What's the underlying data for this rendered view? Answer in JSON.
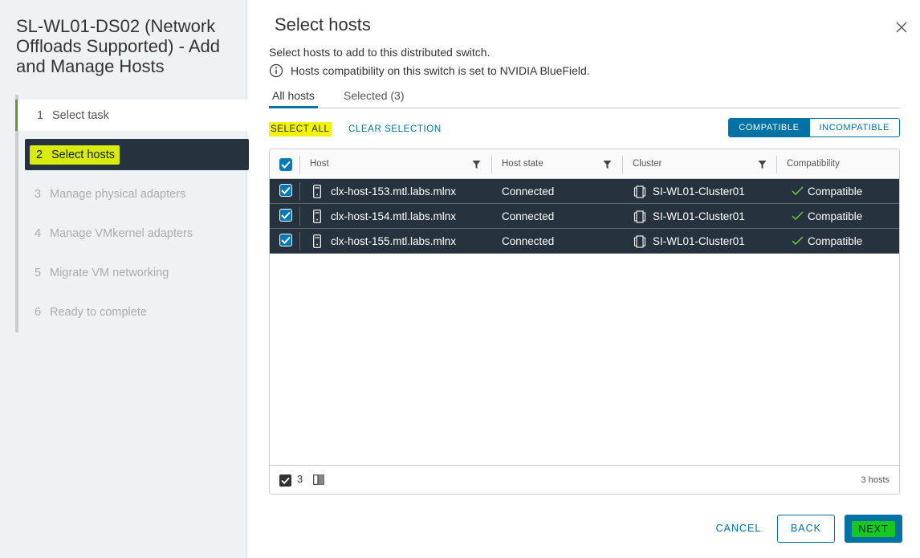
{
  "wizard": {
    "title": "SL-WL01-DS02 (Network Offloads Supported) - Add and Manage Hosts",
    "steps": [
      {
        "num": "1",
        "label": "Select task"
      },
      {
        "num": "2",
        "label": "Select hosts"
      },
      {
        "num": "3",
        "label": "Manage physical adapters"
      },
      {
        "num": "4",
        "label": "Manage VMkernel adapters"
      },
      {
        "num": "5",
        "label": "Migrate VM networking"
      },
      {
        "num": "6",
        "label": "Ready to complete"
      }
    ]
  },
  "page": {
    "title": "Select hosts",
    "subtitle": "Select hosts to add to this distributed switch.",
    "compat_note": "Hosts compatibility on this switch is set to NVIDIA BlueField."
  },
  "tabs": {
    "all": "All hosts",
    "selected": "Selected (3)"
  },
  "actions": {
    "select_all": "SELECT ALL",
    "clear_selection": "CLEAR SELECTION"
  },
  "filter_toggle": {
    "compatible": "COMPATIBLE",
    "incompatible": "INCOMPATIBLE"
  },
  "grid": {
    "columns": {
      "host": "Host",
      "state": "Host state",
      "cluster": "Cluster",
      "compat": "Compatibility"
    },
    "rows": [
      {
        "host": "clx-host-153.mtl.labs.mlnx",
        "state": "Connected",
        "cluster": "SI-WL01-Cluster01",
        "compat": "Compatible"
      },
      {
        "host": "clx-host-154.mtl.labs.mlnx",
        "state": "Connected",
        "cluster": "SI-WL01-Cluster01",
        "compat": "Compatible"
      },
      {
        "host": "clx-host-155.mtl.labs.mlnx",
        "state": "Connected",
        "cluster": "SI-WL01-Cluster01",
        "compat": "Compatible"
      }
    ],
    "footer": {
      "selected_count": "3",
      "total": "3 hosts"
    }
  },
  "buttons": {
    "cancel": "CANCEL",
    "back": "BACK",
    "next": "NEXT"
  },
  "colors": {
    "accent": "#0072a3",
    "row_selected": "#26333e",
    "step_done": "#5b9e2d",
    "highlight_yellow": "#f2f20a",
    "highlight_green": "#19c81e"
  }
}
